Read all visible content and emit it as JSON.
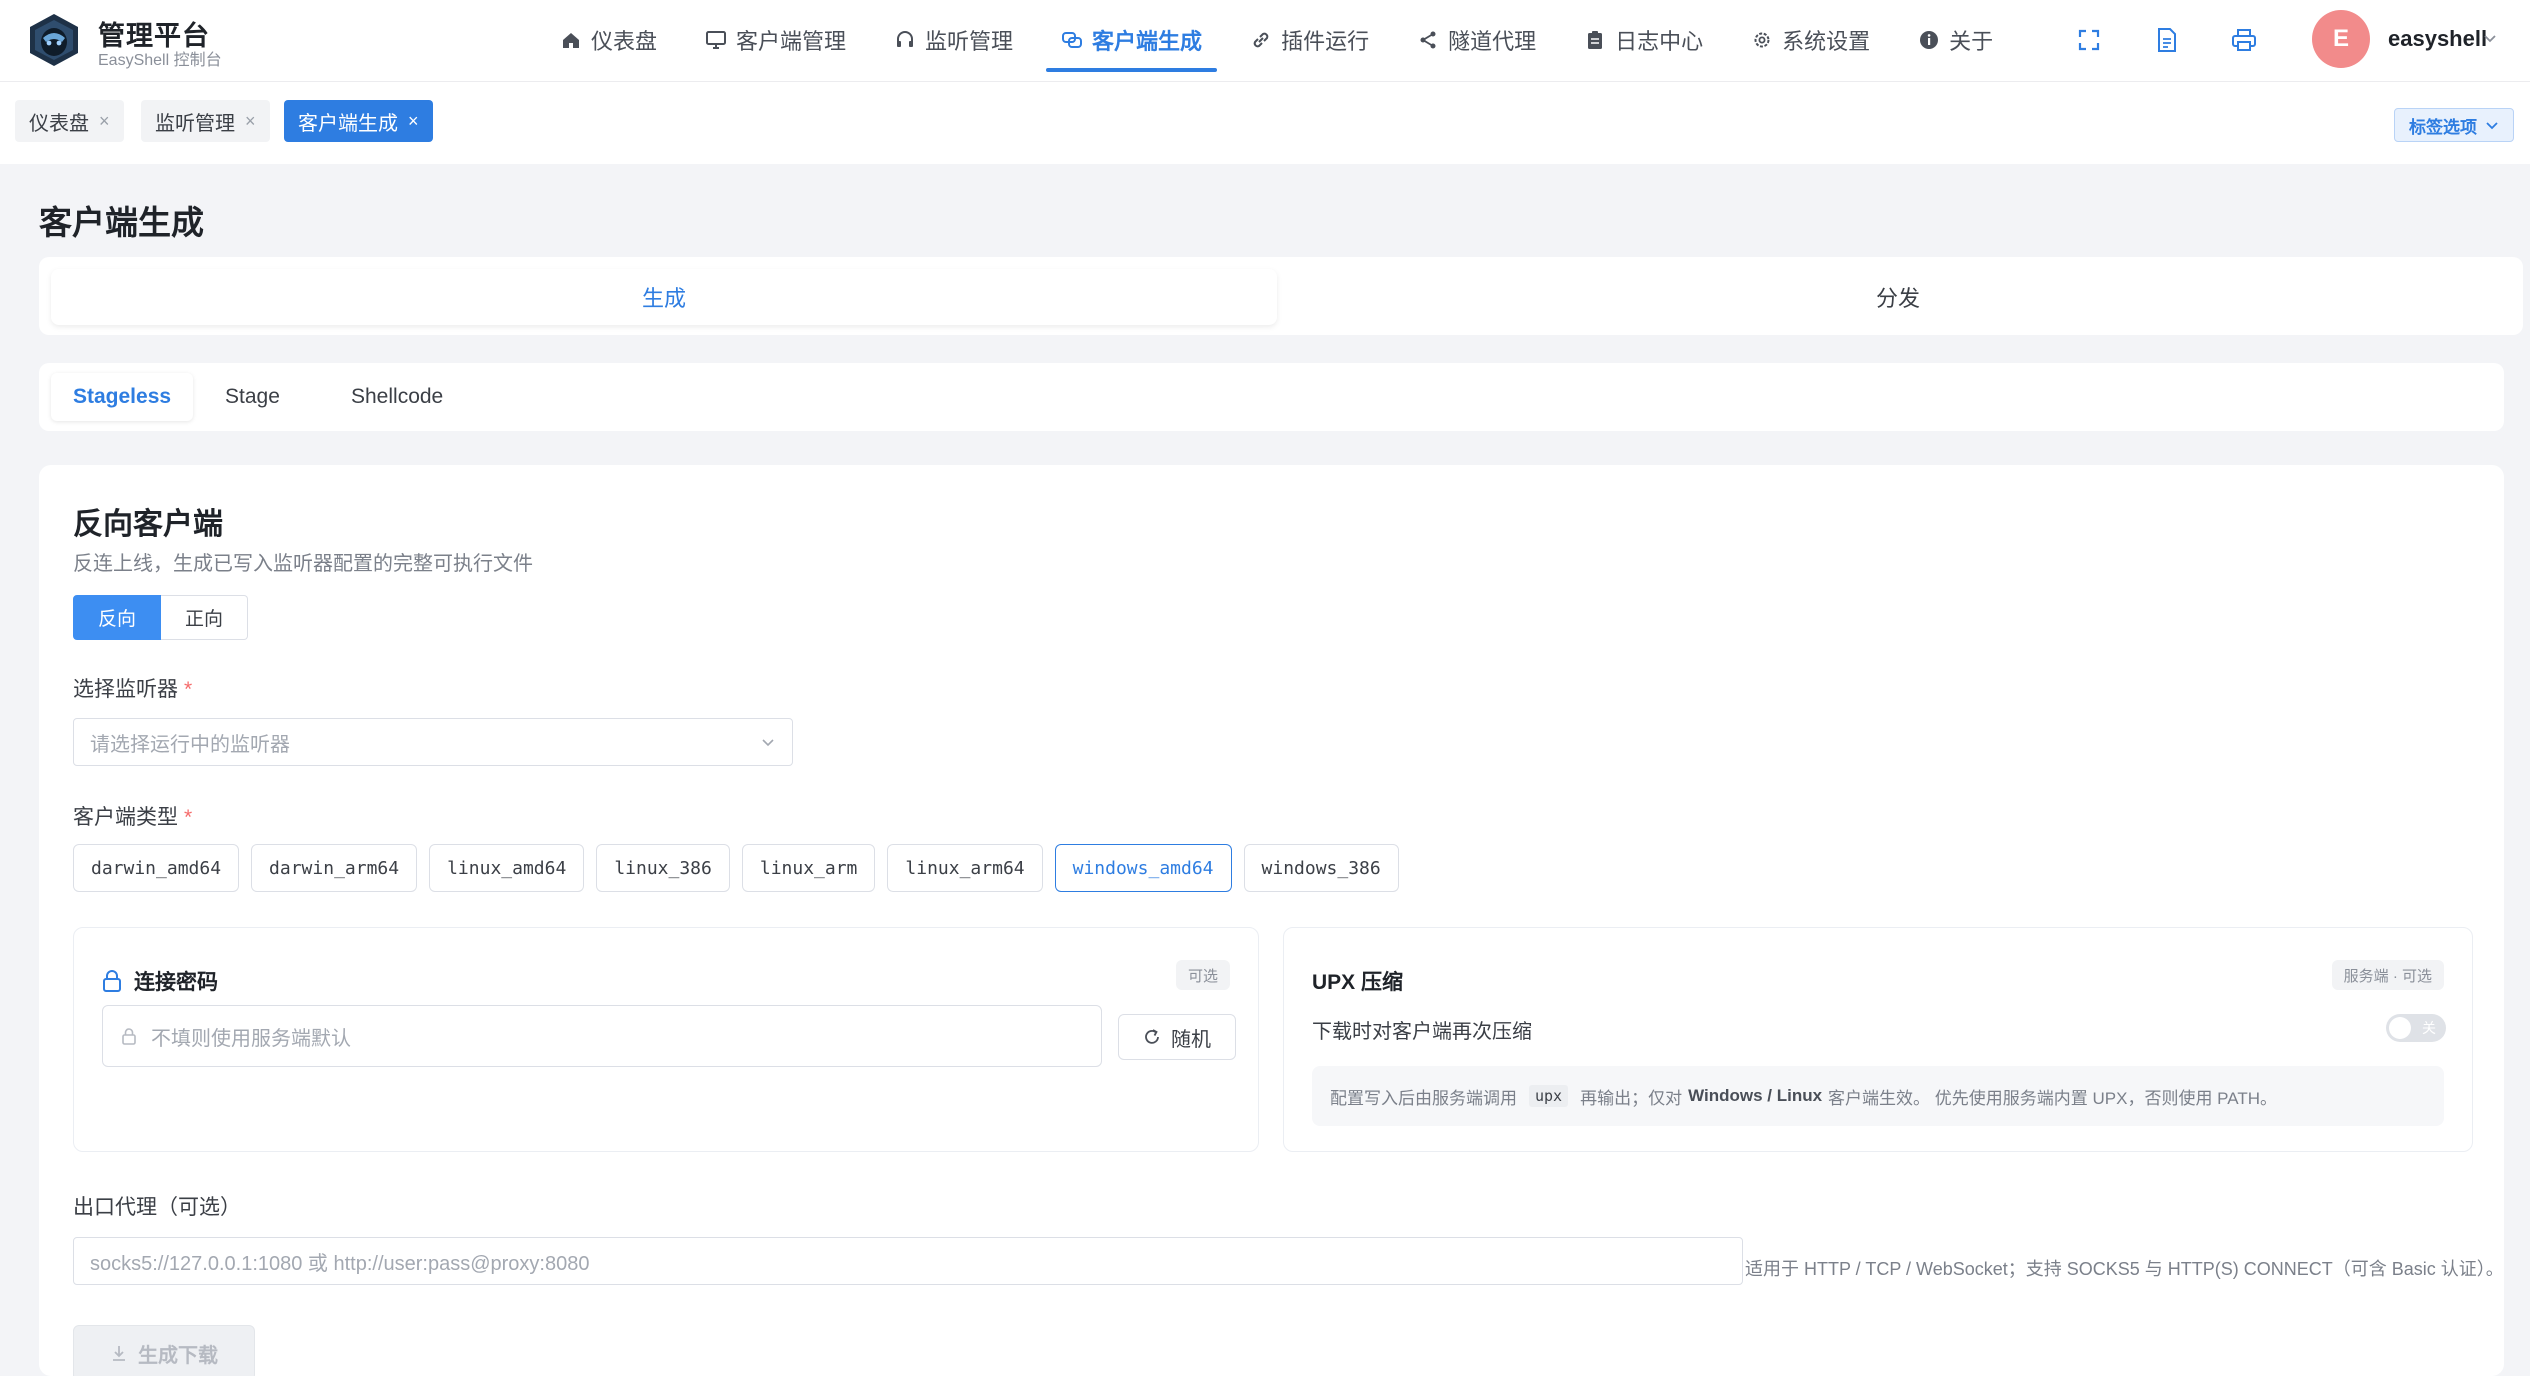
{
  "brand": {
    "title": "管理平台",
    "subtitle": "EasyShell 控制台"
  },
  "nav": [
    {
      "label": "仪表盘",
      "icon": "home-icon"
    },
    {
      "label": "客户端管理",
      "icon": "monitor-icon"
    },
    {
      "label": "监听管理",
      "icon": "headset-icon"
    },
    {
      "label": "客户端生成",
      "icon": "link-cards-icon",
      "active": true
    },
    {
      "label": "插件运行",
      "icon": "link-icon"
    },
    {
      "label": "隧道代理",
      "icon": "share-icon"
    },
    {
      "label": "日志中心",
      "icon": "clipboard-icon"
    },
    {
      "label": "系统设置",
      "icon": "gear-icon"
    },
    {
      "label": "关于",
      "icon": "info-icon"
    }
  ],
  "user": {
    "avatar_letter": "E",
    "name": "easyshell"
  },
  "tags": [
    {
      "label": "仪表盘"
    },
    {
      "label": "监听管理"
    },
    {
      "label": "客户端生成",
      "active": true
    }
  ],
  "tag_options_label": "标签选项",
  "page_title": "客户端生成",
  "mode_tabs": {
    "generate": "生成",
    "distribute": "分发"
  },
  "sub_tabs": [
    "Stageless",
    "Stage",
    "Shellcode"
  ],
  "card": {
    "title": "反向客户端",
    "desc": "反连上线，生成已写入监听器配置的完整可执行文件",
    "direction": {
      "reverse": "反向",
      "forward": "正向"
    },
    "listener_label": "选择监听器",
    "listener_placeholder": "请选择运行中的监听器",
    "type_label": "客户端类型",
    "types": [
      "darwin_amd64",
      "darwin_arm64",
      "linux_amd64",
      "linux_386",
      "linux_arm",
      "linux_arm64",
      "windows_amd64",
      "windows_386"
    ],
    "selected_type": "windows_amd64",
    "password": {
      "title": "连接密码",
      "badge": "可选",
      "placeholder": "不填则使用服务端默认",
      "random_label": "随机"
    },
    "upx": {
      "title": "UPX 压缩",
      "badge": "服务端 · 可选",
      "label": "下载时对客户端再次压缩",
      "toggle_text": "关",
      "toggle_on": false,
      "note_pre": "配置写入后由服务端调用",
      "note_code": "upx",
      "note_mid": "再输出；仅对",
      "note_bold": "Windows / Linux",
      "note_post": "客户端生效。 优先使用服务端内置 UPX，否则使用 PATH。"
    },
    "proxy_label": "出口代理（可选）",
    "proxy_placeholder": "socks5://127.0.0.1:1080 或 http://user:pass@proxy:8080",
    "proxy_note": "适用于 HTTP / TCP / WebSocket；支持 SOCKS5 与 HTTP(S) CONNECT（可含 Basic 认证）。",
    "generate_label": "生成下载"
  },
  "colors": {
    "accent": "#2e7de1",
    "required": "#f56c6c",
    "avatar": "#f28b8b"
  }
}
